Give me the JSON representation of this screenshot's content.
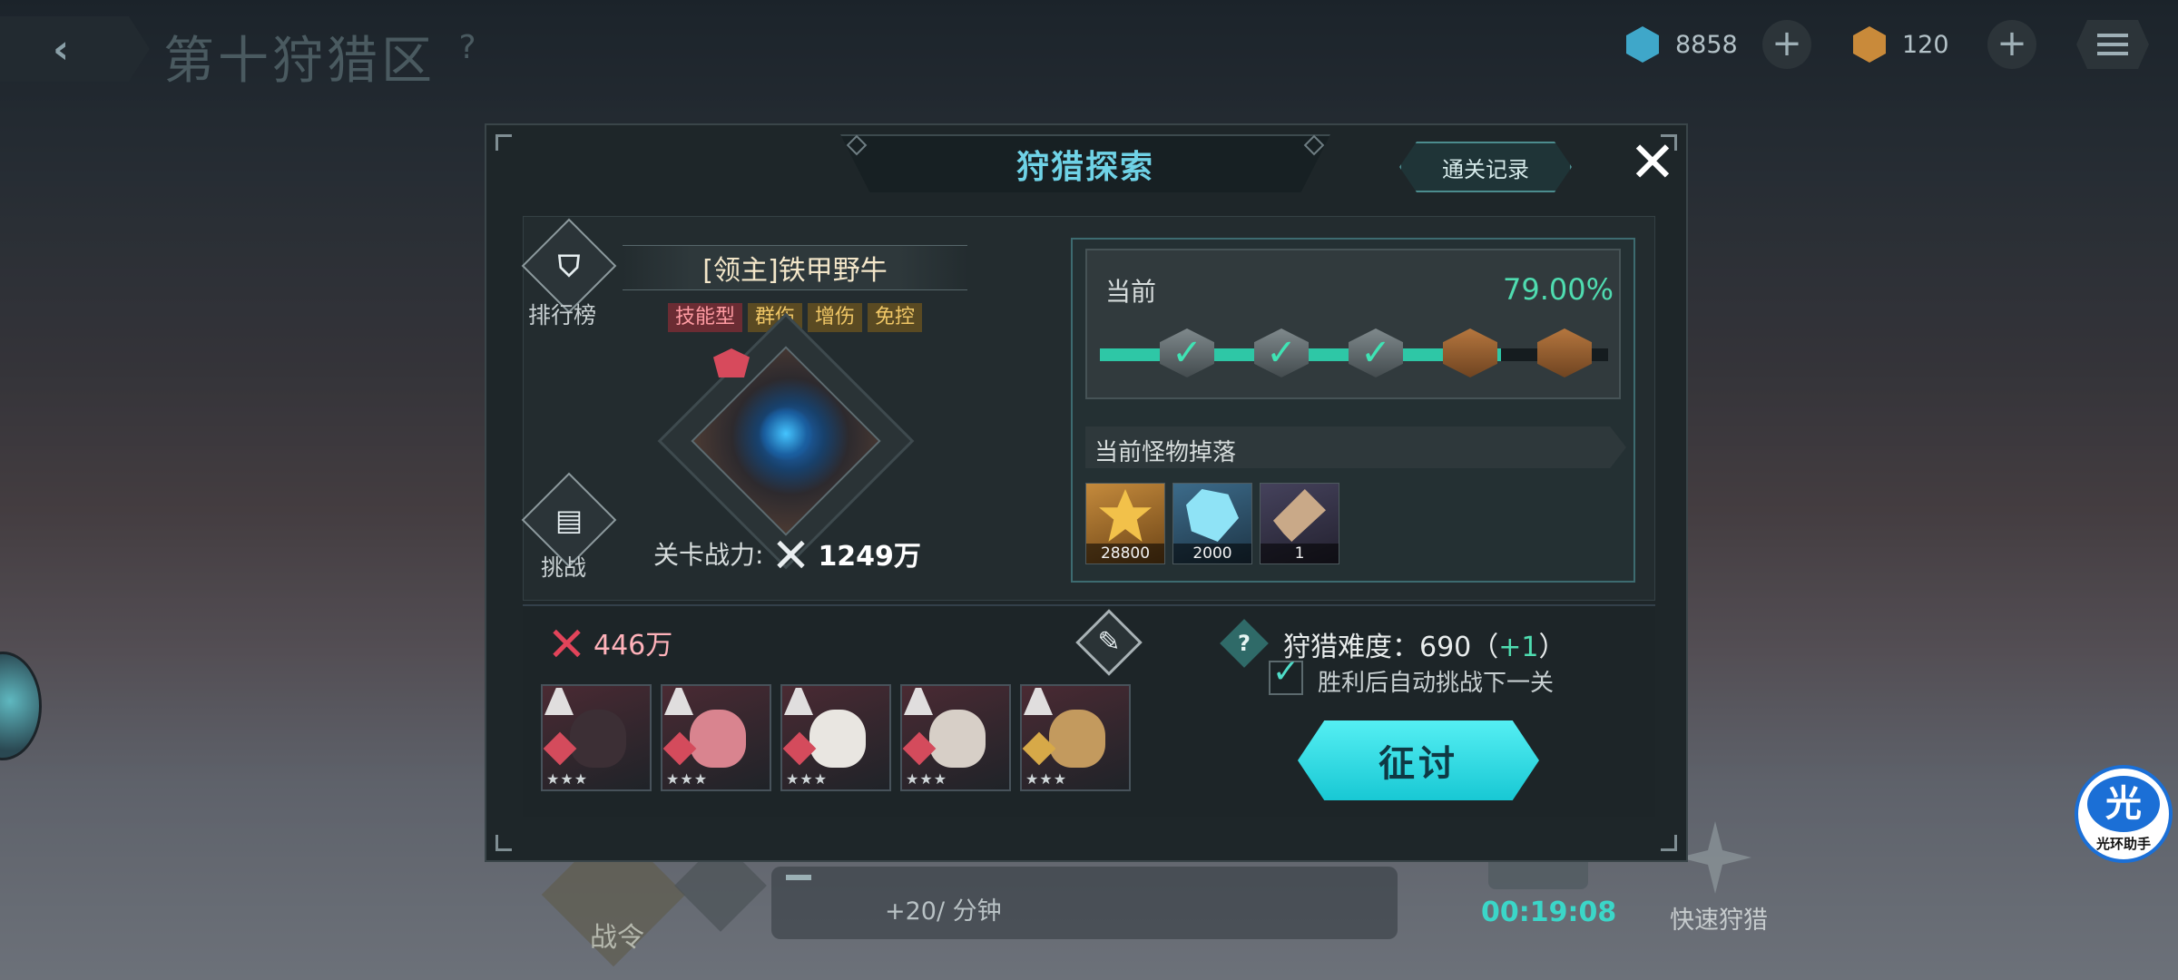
{
  "header": {
    "zone_title": "第十狩猎区",
    "help": "?",
    "currency_1": {
      "value": "8858",
      "color": "#3fa7c9",
      "icon": "crystal-icon"
    },
    "currency_2": {
      "value": "120",
      "color": "#c98a3a",
      "icon": "ore-icon"
    }
  },
  "background_hud": {
    "token_label": "战令",
    "rate": "+20/ 分钟",
    "timer": "00:19:08",
    "quick_hunt": "快速狩猎"
  },
  "assistant": {
    "glyph": "光",
    "label": "光环助手"
  },
  "modal": {
    "title": "狩猎探索",
    "record_button": "通关记录",
    "close": "✕",
    "boss": {
      "name": "[领主]铁甲野牛",
      "tags": [
        "技能型",
        "群伤",
        "增伤",
        "免控"
      ],
      "power_label": "关卡战力:",
      "power_value": "1249万"
    },
    "rank_label": "排行榜",
    "challenge_label": "挑战",
    "progress": {
      "label": "当前",
      "percent_text": "79.00%",
      "fill_fraction": 0.79,
      "nodes": [
        "done",
        "done",
        "done",
        "chest",
        "chest"
      ]
    },
    "drops": {
      "title": "当前怪物掉落",
      "items": [
        {
          "name": "medal-icon",
          "count": "28800"
        },
        {
          "name": "crystal-icon",
          "count": "2000"
        },
        {
          "name": "drill-icon",
          "count": "1"
        }
      ]
    },
    "team": {
      "power": "446万",
      "heroes": [
        {
          "face": "#3c2f35",
          "elem": "red",
          "stars": "★★★"
        },
        {
          "face": "#d9848f",
          "elem": "red",
          "stars": "★★★"
        },
        {
          "face": "#e9e6e1",
          "elem": "red",
          "stars": "★★★"
        },
        {
          "face": "#d7cfc7",
          "elem": "red",
          "stars": "★★★"
        },
        {
          "face": "#c39a5e",
          "elem": "gold",
          "stars": "★★★"
        }
      ]
    },
    "difficulty": {
      "label": "狩猎难度：",
      "value": "690",
      "bonus": "+1"
    },
    "auto_next": {
      "checked": true,
      "label": "胜利后自动挑战下一关"
    },
    "start_button": "征讨"
  }
}
